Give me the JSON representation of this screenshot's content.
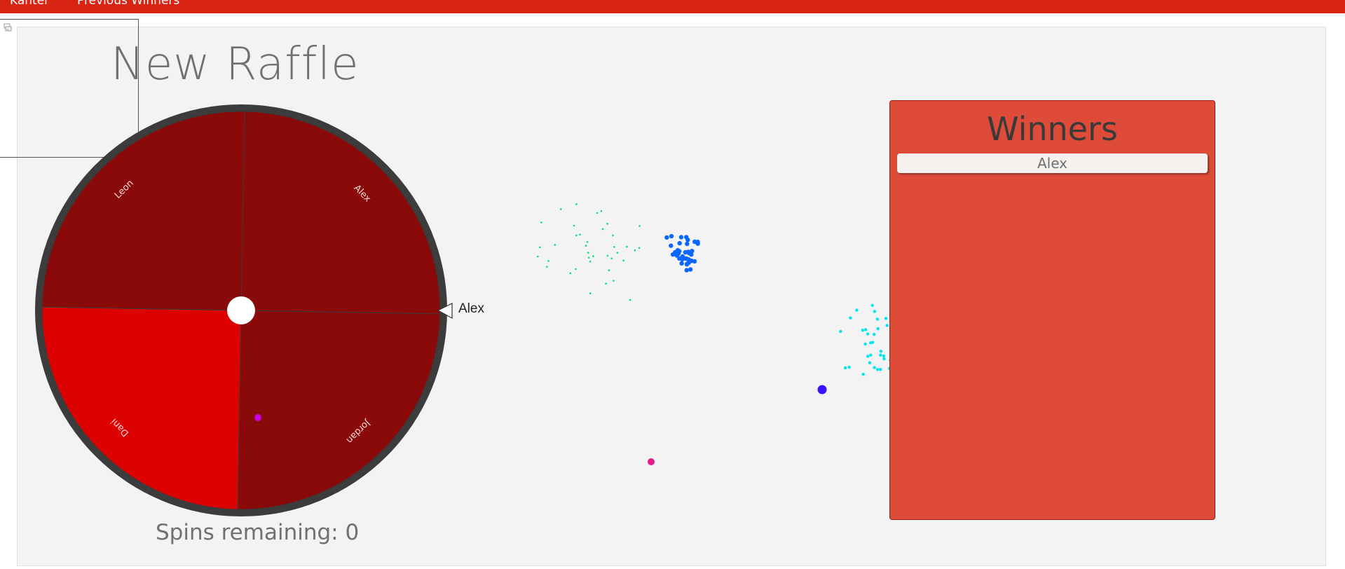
{
  "nav": {
    "items": [
      "Kanter",
      "Previous Winners"
    ]
  },
  "raffle": {
    "title": "New Raffle",
    "spins_label": "Spins remaining: 0",
    "pointer_label": "Alex",
    "segments": [
      {
        "name": "Alex",
        "color": "#8a0909"
      },
      {
        "name": "Jordan",
        "color": "#8a0909"
      },
      {
        "name": "Dani",
        "color": "#dc0202"
      },
      {
        "name": "Leon",
        "color": "#8a0909"
      }
    ],
    "rim_color": "#3c3c3c"
  },
  "winners": {
    "title": "Winners",
    "list": [
      "Alex"
    ]
  },
  "colors": {
    "topbar": "#d92414",
    "winners_bg": "#de4b39",
    "confetti": [
      "#00e07a",
      "#0a66ff",
      "#00e6f0",
      "#c800e0",
      "#e61a8c",
      "#3a14ff"
    ]
  },
  "icons": {
    "broken_image": "broken-image-icon",
    "pointer": "triangle-pointer-icon"
  }
}
